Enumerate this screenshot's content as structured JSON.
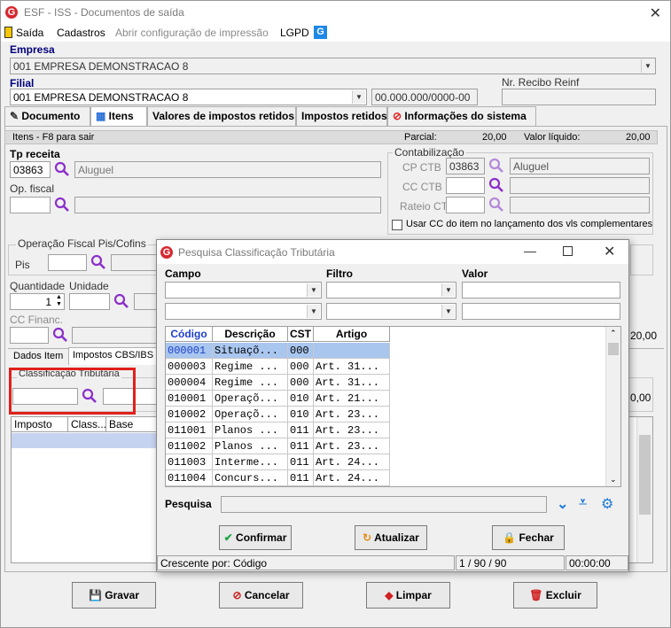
{
  "window": {
    "title": "ESF - ISS - Documentos de saída"
  },
  "menu": {
    "saida": "Saída",
    "cadastros": "Cadastros",
    "abrir_config": "Abrir configuração de impressão",
    "lgpd": "LGPD"
  },
  "empresa": {
    "label": "Empresa",
    "value": "001 EMPRESA DEMONSTRACAO 8"
  },
  "filial": {
    "label": "Filial",
    "value": "001 EMPRESA DEMONSTRACAO 8",
    "cnpj": "00.000.000/0000-00",
    "recibo_label": "Nr. Recibo Reinf",
    "recibo_value": ""
  },
  "tabs": [
    {
      "label": "Documento"
    },
    {
      "label": "Itens"
    },
    {
      "label": "Valores de impostos retidos"
    },
    {
      "label": "Impostos retidos"
    },
    {
      "label": "Informações do sistema"
    }
  ],
  "itens_bar": {
    "hint": "Itens - F8 para sair",
    "parcial_label": "Parcial:",
    "parcial_value": "20,00",
    "liquido_label": "Valor líquido:",
    "liquido_value": "20,00"
  },
  "tp_receita": {
    "label": "Tp receita",
    "code": "03863",
    "desc": "Aluguel"
  },
  "op_fiscal": {
    "label": "Op. fiscal"
  },
  "contabilizacao": {
    "title": "Contabilização",
    "cp_label": "CP CTB",
    "cp_code": "03863",
    "cp_desc": "Aluguel",
    "cc_label": "CC CTB",
    "rateio_label": "Rateio CTB",
    "checkbox_label": "Usar CC do item no lançamento dos vls complementares"
  },
  "op_pis_cofins": {
    "title": "Operação Fiscal Pis/Cofins",
    "pis_label": "Pis"
  },
  "quantidade": {
    "label": "Quantidade",
    "value": "1"
  },
  "unidade": {
    "label": "Unidade"
  },
  "cc_financ": {
    "label": "CC Financ."
  },
  "side_values": {
    "v1": "20,00",
    "v2": "0,00"
  },
  "subtabs": [
    {
      "label": "Dados Item"
    },
    {
      "label": "Impostos CBS/IBS"
    }
  ],
  "classificacao": {
    "title": "Classificação Tributária"
  },
  "impostos_grid": {
    "headers": [
      "Imposto",
      "Class...",
      "Base"
    ]
  },
  "bottom_buttons": {
    "gravar": "Gravar",
    "cancelar": "Cancelar",
    "limpar": "Limpar",
    "excluir": "Excluir"
  },
  "dialog": {
    "title": "Pesquisa Classificação Tributária",
    "campo_label": "Campo",
    "filtro_label": "Filtro",
    "valor_label": "Valor",
    "headers": [
      "Código",
      "Descrição",
      "CST",
      "Artigo"
    ],
    "rows": [
      [
        "000001",
        "Situaçõ...",
        "000",
        ""
      ],
      [
        "000003",
        "Regime ...",
        "000",
        "Art. 31..."
      ],
      [
        "000004",
        "Regime ...",
        "000",
        "Art. 31..."
      ],
      [
        "010001",
        "Operaçõ...",
        "010",
        "Art. 21..."
      ],
      [
        "010002",
        "Operaçõ...",
        "010",
        "Art. 23..."
      ],
      [
        "011001",
        "Planos ...",
        "011",
        "Art. 23..."
      ],
      [
        "011002",
        "Planos ...",
        "011",
        "Art. 23..."
      ],
      [
        "011003",
        "Interme...",
        "011",
        "Art. 24..."
      ],
      [
        "011004",
        "Concurs...",
        "011",
        "Art. 24..."
      ]
    ],
    "pesquisa_label": "Pesquisa",
    "confirmar": "Confirmar",
    "atualizar": "Atualizar",
    "fechar": "Fechar",
    "status_order": "Crescente por: Código",
    "status_count": "1 / 90 / 90",
    "status_time": "00:00:00"
  }
}
